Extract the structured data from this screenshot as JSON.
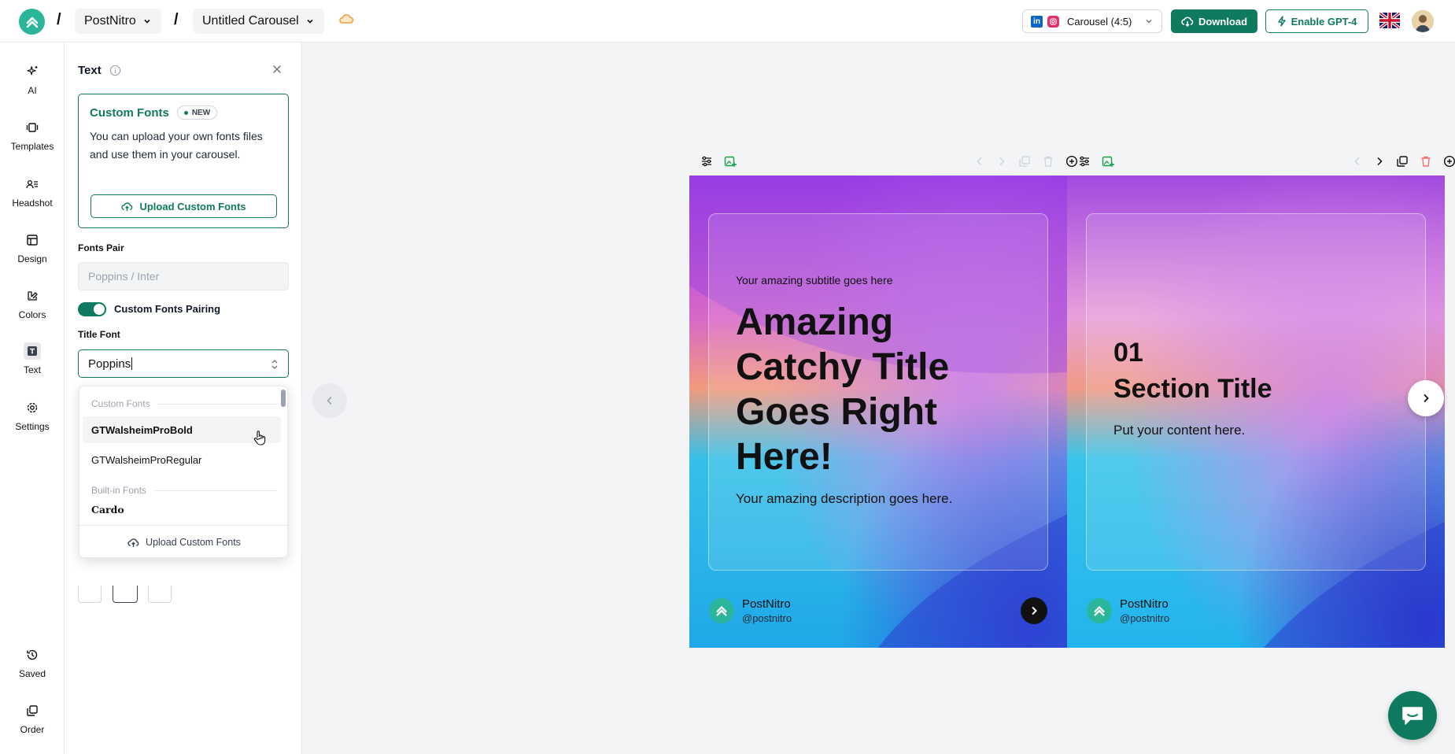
{
  "header": {
    "workspace": "PostNitro",
    "carousel_name": "Untitled Carousel",
    "separator": "/",
    "format_label": "Carousel (4:5)",
    "linkedin_glyph": "in",
    "download_label": "Download",
    "gpt_label": "Enable GPT-4"
  },
  "nav": {
    "items": [
      {
        "label": "AI",
        "icon": "sparkle-icon"
      },
      {
        "label": "Templates",
        "icon": "templates-icon"
      },
      {
        "label": "Headshot",
        "icon": "headshot-icon"
      },
      {
        "label": "Design",
        "icon": "layout-icon"
      },
      {
        "label": "Colors",
        "icon": "palette-icon"
      },
      {
        "label": "Text",
        "icon": "text-icon"
      },
      {
        "label": "Settings",
        "icon": "gear-icon"
      },
      {
        "label": "Saved",
        "icon": "history-icon"
      },
      {
        "label": "Order",
        "icon": "copy-icon"
      }
    ],
    "active": "Text"
  },
  "panel": {
    "title": "Text",
    "custom_fonts": {
      "title": "Custom Fonts",
      "badge": "NEW",
      "body": "You can upload your own fonts files and use them in your carousel.",
      "upload_label": "Upload Custom Fonts"
    },
    "fonts_pair_label": "Fonts Pair",
    "fonts_pair_placeholder": "Poppins / Inter",
    "pairing_label": "Custom Fonts Pairing",
    "pairing_enabled": true,
    "title_font_label": "Title Font",
    "title_font_value": "Poppins"
  },
  "dropdown": {
    "groups": [
      {
        "label": "Custom Fonts",
        "options": [
          "GTWalsheimProBold",
          "GTWalsheimProRegular"
        ]
      },
      {
        "label": "Built-in Fonts",
        "options": [
          "Cardo"
        ]
      }
    ],
    "hovered": "GTWalsheimProBold",
    "footer_label": "Upload Custom Fonts"
  },
  "slides": [
    {
      "subtitle": "Your amazing subtitle goes here",
      "title": "Amazing Catchy Title Goes Right Here!",
      "description": "Your amazing description goes here.",
      "brand_name": "PostNitro",
      "brand_handle": "@postnitro"
    },
    {
      "number": "01",
      "title": "Section Title",
      "content": "Put your content here.",
      "brand_name": "PostNitro",
      "brand_handle": "@postnitro"
    }
  ],
  "colors": {
    "accent": "#0f7a5f",
    "brand_logo": "#2bb59a"
  }
}
